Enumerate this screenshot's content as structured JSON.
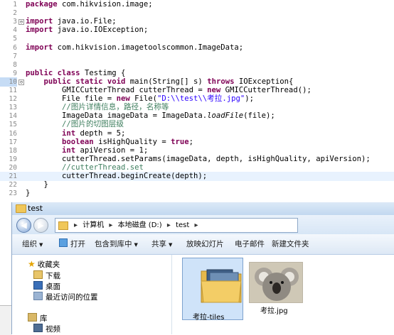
{
  "editor": {
    "lines": [
      {
        "n": "1",
        "tokens": [
          {
            "t": "package",
            "c": "kw"
          },
          {
            "t": " com.hikvision.image;"
          }
        ]
      },
      {
        "n": "2",
        "tokens": []
      },
      {
        "n": "3",
        "fold": "⊖",
        "tokens": [
          {
            "t": "import",
            "c": "kw"
          },
          {
            "t": " java.io.File;"
          }
        ]
      },
      {
        "n": "4",
        "tokens": [
          {
            "t": "import",
            "c": "kw"
          },
          {
            "t": " java.io.IOException;"
          }
        ]
      },
      {
        "n": "5",
        "tokens": []
      },
      {
        "n": "6",
        "tokens": [
          {
            "t": "import",
            "c": "kw"
          },
          {
            "t": " com.hikvision.imagetoolscommon.ImageData;"
          }
        ]
      },
      {
        "n": "7",
        "tokens": []
      },
      {
        "n": "8",
        "tokens": []
      },
      {
        "n": "9",
        "tokens": [
          {
            "t": "public",
            "c": "kw"
          },
          {
            "t": " "
          },
          {
            "t": "class",
            "c": "kw"
          },
          {
            "t": " Testimg {"
          }
        ]
      },
      {
        "n": "10",
        "fold": "⊖",
        "hl": true,
        "tokens": [
          {
            "t": "    "
          },
          {
            "t": "public",
            "c": "kw"
          },
          {
            "t": " "
          },
          {
            "t": "static",
            "c": "kw"
          },
          {
            "t": " "
          },
          {
            "t": "void",
            "c": "kw"
          },
          {
            "t": " main(String[] s) "
          },
          {
            "t": "throws",
            "c": "kw"
          },
          {
            "t": " IOException{"
          }
        ]
      },
      {
        "n": "11",
        "tokens": [
          {
            "t": "        GMICCutterThread cutterThread = "
          },
          {
            "t": "new",
            "c": "kw"
          },
          {
            "t": " GMICCutterThread();"
          }
        ]
      },
      {
        "n": "12",
        "tokens": [
          {
            "t": "        File file = "
          },
          {
            "t": "new",
            "c": "kw"
          },
          {
            "t": " File("
          },
          {
            "t": "\"D:\\\\test\\\\考拉.jpg\"",
            "c": "str"
          },
          {
            "t": ");"
          }
        ]
      },
      {
        "n": "13",
        "tokens": [
          {
            "t": "        "
          },
          {
            "t": "//图片详情信息，路径，名称等",
            "c": "cmt"
          }
        ]
      },
      {
        "n": "14",
        "tokens": [
          {
            "t": "        ImageData imageData = ImageData."
          },
          {
            "t": "loadFile",
            "c": "it"
          },
          {
            "t": "(file);"
          }
        ]
      },
      {
        "n": "15",
        "tokens": [
          {
            "t": "        "
          },
          {
            "t": "//图片的切图层级",
            "c": "cmt"
          }
        ]
      },
      {
        "n": "16",
        "tokens": [
          {
            "t": "        "
          },
          {
            "t": "int",
            "c": "kw"
          },
          {
            "t": " depth = 5;"
          }
        ]
      },
      {
        "n": "17",
        "tokens": [
          {
            "t": "        "
          },
          {
            "t": "boolean",
            "c": "kw"
          },
          {
            "t": " isHighQuality = "
          },
          {
            "t": "true",
            "c": "kw"
          },
          {
            "t": ";"
          }
        ]
      },
      {
        "n": "18",
        "tokens": [
          {
            "t": "        "
          },
          {
            "t": "int",
            "c": "kw"
          },
          {
            "t": " apiVersion = 1;"
          }
        ]
      },
      {
        "n": "19",
        "tokens": [
          {
            "t": "        cutterThread.setParams(imageData, depth, isHighQuality, apiVersion);"
          }
        ]
      },
      {
        "n": "20",
        "tokens": [
          {
            "t": "        "
          },
          {
            "t": "//cutterThread.set",
            "c": "cmt"
          }
        ]
      },
      {
        "n": "21",
        "cur": true,
        "tokens": [
          {
            "t": "        cutterThread.beginCreate(depth);"
          }
        ]
      },
      {
        "n": "22",
        "tokens": [
          {
            "t": "    }"
          }
        ]
      },
      {
        "n": "23",
        "tokens": [
          {
            "t": "}"
          }
        ]
      }
    ]
  },
  "explorer": {
    "title": "test",
    "address": {
      "crumbs": [
        "计算机",
        "本地磁盘 (D:)",
        "test"
      ],
      "separator": "▸"
    },
    "toolbar": {
      "organize": "组织",
      "open": "打开",
      "include_in_library": "包含到库中",
      "share": "共享",
      "slideshow": "放映幻灯片",
      "email": "电子邮件",
      "new_folder": "新建文件夹"
    },
    "sidebar": {
      "favorites": "收藏夹",
      "downloads": "下载",
      "desktop": "桌面",
      "recent": "最近访问的位置",
      "library": "库",
      "videos": "视频"
    },
    "files": [
      {
        "name": "考拉-tiles",
        "icon": "folder-icon"
      },
      {
        "name": "考拉.jpg",
        "icon": "image-thumbnail"
      }
    ]
  },
  "colors": {
    "keyword": "#7f0055",
    "string": "#2a00ff",
    "comment": "#3f7f5f",
    "current_line": "#e8f2fe",
    "selection": "#cfe3f9"
  }
}
